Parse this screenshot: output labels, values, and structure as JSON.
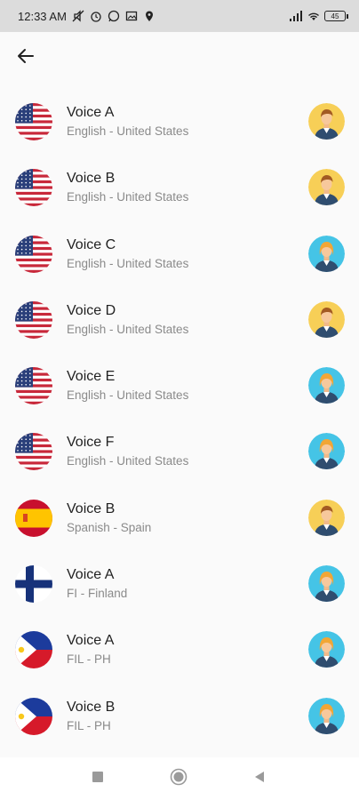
{
  "status_bar": {
    "time": "12:33 AM",
    "battery": "45",
    "icons": [
      "mute-icon",
      "alarm-icon",
      "whatsapp-icon",
      "gallery-icon",
      "location-icon",
      "signal-icon",
      "wifi-icon",
      "battery-icon"
    ]
  },
  "app_bar": {
    "back_icon": "arrow-left-icon"
  },
  "voices": [
    {
      "name": "Voice A",
      "language": "English - United States",
      "flag": "us",
      "gender": "male"
    },
    {
      "name": "Voice B",
      "language": "English - United States",
      "flag": "us",
      "gender": "male"
    },
    {
      "name": "Voice C",
      "language": "English - United States",
      "flag": "us",
      "gender": "female"
    },
    {
      "name": "Voice D",
      "language": "English - United States",
      "flag": "us",
      "gender": "male"
    },
    {
      "name": "Voice E",
      "language": "English - United States",
      "flag": "us",
      "gender": "female"
    },
    {
      "name": "Voice F",
      "language": "English - United States",
      "flag": "us",
      "gender": "female"
    },
    {
      "name": "Voice B",
      "language": "Spanish - Spain",
      "flag": "es",
      "gender": "male"
    },
    {
      "name": "Voice A",
      "language": "FI - Finland",
      "flag": "fi",
      "gender": "female"
    },
    {
      "name": "Voice A",
      "language": "FIL - PH",
      "flag": "ph",
      "gender": "female"
    },
    {
      "name": "Voice B",
      "language": "FIL - PH",
      "flag": "ph",
      "gender": "female"
    }
  ],
  "colors": {
    "male_bg": "#f7cf57",
    "female_bg": "#45c4e6"
  },
  "nav_bar": {
    "icons": [
      "recents-square-icon",
      "home-circle-icon",
      "back-triangle-icon"
    ]
  }
}
